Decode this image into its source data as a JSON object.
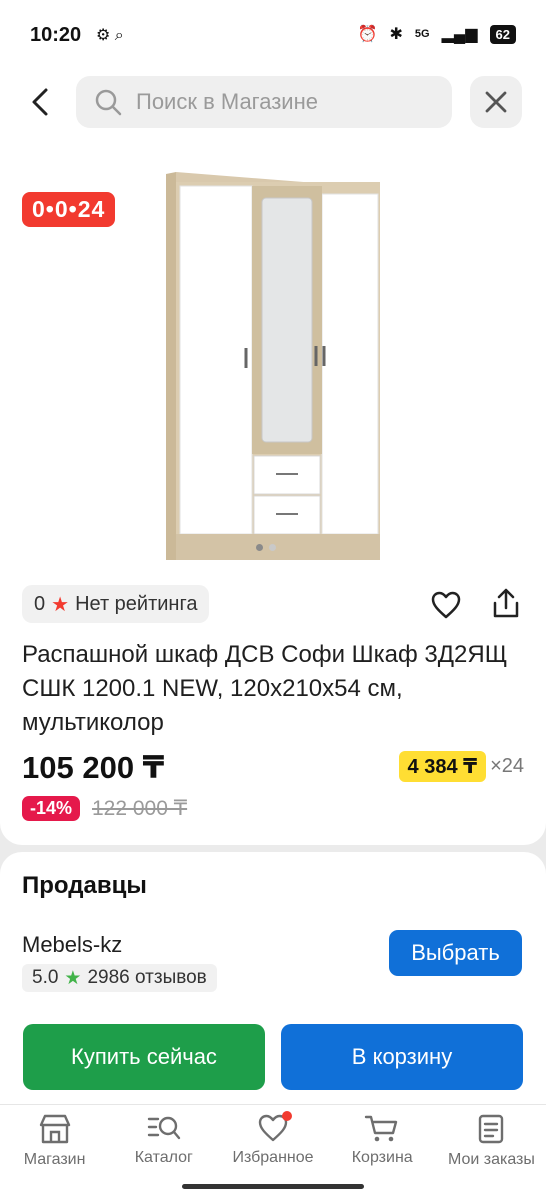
{
  "status_bar": {
    "time": "10:20",
    "network": "5G",
    "battery": "62"
  },
  "search": {
    "placeholder": "Поиск в Магазине"
  },
  "product": {
    "promo_badge": "0•0•24",
    "rating_value": "0",
    "rating_text": "Нет рейтинга",
    "title": "Распашной шкаф ДСВ Софи Шкаф 3Д2ЯЩ СШК 1200.1 NEW, 120х210х54 см, мультиколор",
    "price": "105 200 ₸",
    "installment_amount": "4 384 ₸",
    "installment_times": "×24",
    "discount": "-14%",
    "old_price": "122 000 ₸",
    "image_count": 2,
    "active_image": 1
  },
  "sellers": {
    "title": "Продавцы",
    "seller_name": "Mebels-kz",
    "seller_rating": "5.0",
    "reviews": "2986 отзывов",
    "choose_label": "Выбрать"
  },
  "actions": {
    "buy_now": "Купить сейчас",
    "add_to_cart": "В корзину"
  },
  "bottom_nav": {
    "items": [
      {
        "label": "Магазин",
        "icon": "shop-icon"
      },
      {
        "label": "Каталог",
        "icon": "catalog-search-icon"
      },
      {
        "label": "Избранное",
        "icon": "heart-icon"
      },
      {
        "label": "Корзина",
        "icon": "cart-icon"
      },
      {
        "label": "Мои заказы",
        "icon": "orders-icon"
      }
    ]
  },
  "colors": {
    "promo_red": "#f23a2f",
    "installment_yellow": "#ffde33",
    "discount_pink": "#e5194b",
    "primary_blue": "#1070d8",
    "buy_green": "#1e9e4a"
  }
}
